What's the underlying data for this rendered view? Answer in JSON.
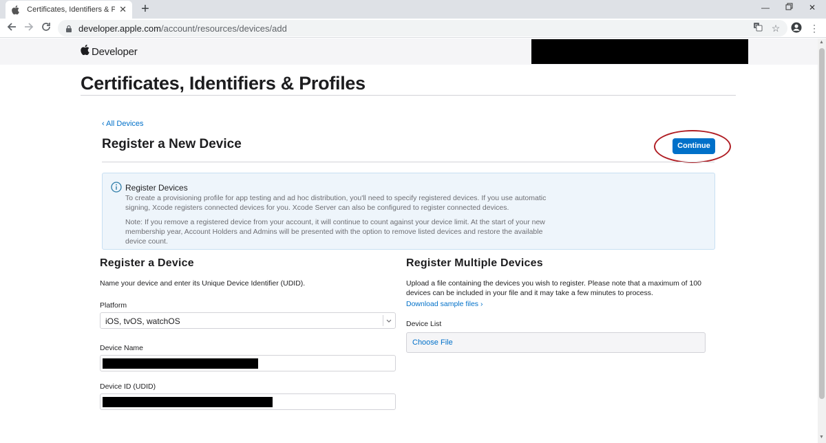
{
  "browser": {
    "tab_title": "Certificates, Identifiers & Profiles",
    "tab_close": "✕",
    "new_tab": "+",
    "url_host": "developer.apple.com",
    "url_path": "/account/resources/devices/add",
    "icons": [
      "back-icon",
      "forward-icon",
      "reload-icon",
      "lock-icon",
      "translate-icon",
      "star-icon",
      "account-icon",
      "menu-icon",
      "minimize-icon",
      "restore-icon",
      "close-icon"
    ]
  },
  "globalnav": {
    "brand": "Developer"
  },
  "page": {
    "title": "Certificates, Identifiers & Profiles"
  },
  "section": {
    "back_link": "‹ All Devices",
    "title": "Register a New Device",
    "continue_label": "Continue"
  },
  "info": {
    "title": "Register Devices",
    "p1": "To create a provisioning profile for app testing and ad hoc distribution, you'll need to specify registered devices. If you use automatic signing, Xcode registers connected devices for you. Xcode Server can also be configured to register connected devices.",
    "p2": "Note: If you remove a registered device from your account, it will continue to count against your device limit. At the start of your new membership year, Account Holders and Admins will be presented with the option to remove listed devices and restore the available device count."
  },
  "register_device": {
    "title": "Register a Device",
    "description": "Name your device and enter its Unique Device Identifier (UDID).",
    "platform_label": "Platform",
    "platform_value": "iOS, tvOS, watchOS",
    "device_name_label": "Device Name",
    "device_id_label": "Device ID (UDID)"
  },
  "register_multiple": {
    "title": "Register Multiple Devices",
    "description": "Upload a file containing the devices you wish to register. Please note that a maximum of 100 devices can be included in your file and it may take a few minutes to process.",
    "download_link": "Download sample files ›",
    "device_list_label": "Device List",
    "choose_file": "Choose File"
  },
  "colors": {
    "accent": "#0070c9",
    "annotation": "#b01e24"
  }
}
